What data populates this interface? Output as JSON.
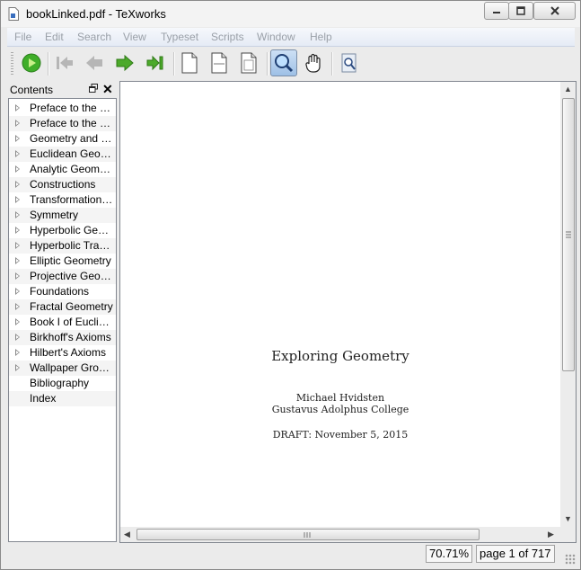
{
  "window": {
    "title": "bookLinked.pdf - TeXworks"
  },
  "menubar": {
    "items": [
      "File",
      "Edit",
      "Search",
      "View",
      "Typeset",
      "Scripts",
      "Window",
      "Help"
    ]
  },
  "toolbar": {
    "buttons": [
      "typeset-run",
      "first-page",
      "previous-page",
      "next-page",
      "last-page",
      "actual-size",
      "fit-width",
      "fit-window",
      "magnify-tool",
      "scroll-tool",
      "find-in-pdf"
    ],
    "active": "magnify-tool",
    "colors": {
      "run_green": "#3fae29",
      "nav_green": "#4caa2a",
      "nav_disabled": "#b6b6b6"
    }
  },
  "sidebar": {
    "title": "Contents",
    "items": [
      {
        "label": "Preface to the Second Edition",
        "expandable": true
      },
      {
        "label": "Preface to the First Edition",
        "expandable": true
      },
      {
        "label": "Geometry and Geometric Proof",
        "expandable": true
      },
      {
        "label": "Euclidean Geometry",
        "expandable": true
      },
      {
        "label": "Analytic Geometry",
        "expandable": true
      },
      {
        "label": "Constructions",
        "expandable": true
      },
      {
        "label": "Transformational Geometry",
        "expandable": true
      },
      {
        "label": "Symmetry",
        "expandable": true
      },
      {
        "label": "Hyperbolic Geometry",
        "expandable": true
      },
      {
        "label": "Hyperbolic Transformations",
        "expandable": true
      },
      {
        "label": "Elliptic Geometry",
        "expandable": true
      },
      {
        "label": "Projective Geometry",
        "expandable": true
      },
      {
        "label": "Foundations",
        "expandable": true
      },
      {
        "label": "Fractal Geometry",
        "expandable": true
      },
      {
        "label": "Book I of Euclid's Elements",
        "expandable": true
      },
      {
        "label": "Birkhoff's Axioms",
        "expandable": true
      },
      {
        "label": "Hilbert's Axioms",
        "expandable": true
      },
      {
        "label": "Wallpaper Groups",
        "expandable": true
      },
      {
        "label": "Bibliography",
        "expandable": false
      },
      {
        "label": "Index",
        "expandable": false
      }
    ]
  },
  "document": {
    "title": "Exploring Geometry",
    "author": "Michael Hvidsten",
    "affiliation": "Gustavus Adolphus College",
    "date": "DRAFT: November 5, 2015"
  },
  "status": {
    "zoom": "70.71%",
    "page": "page 1 of 717"
  }
}
